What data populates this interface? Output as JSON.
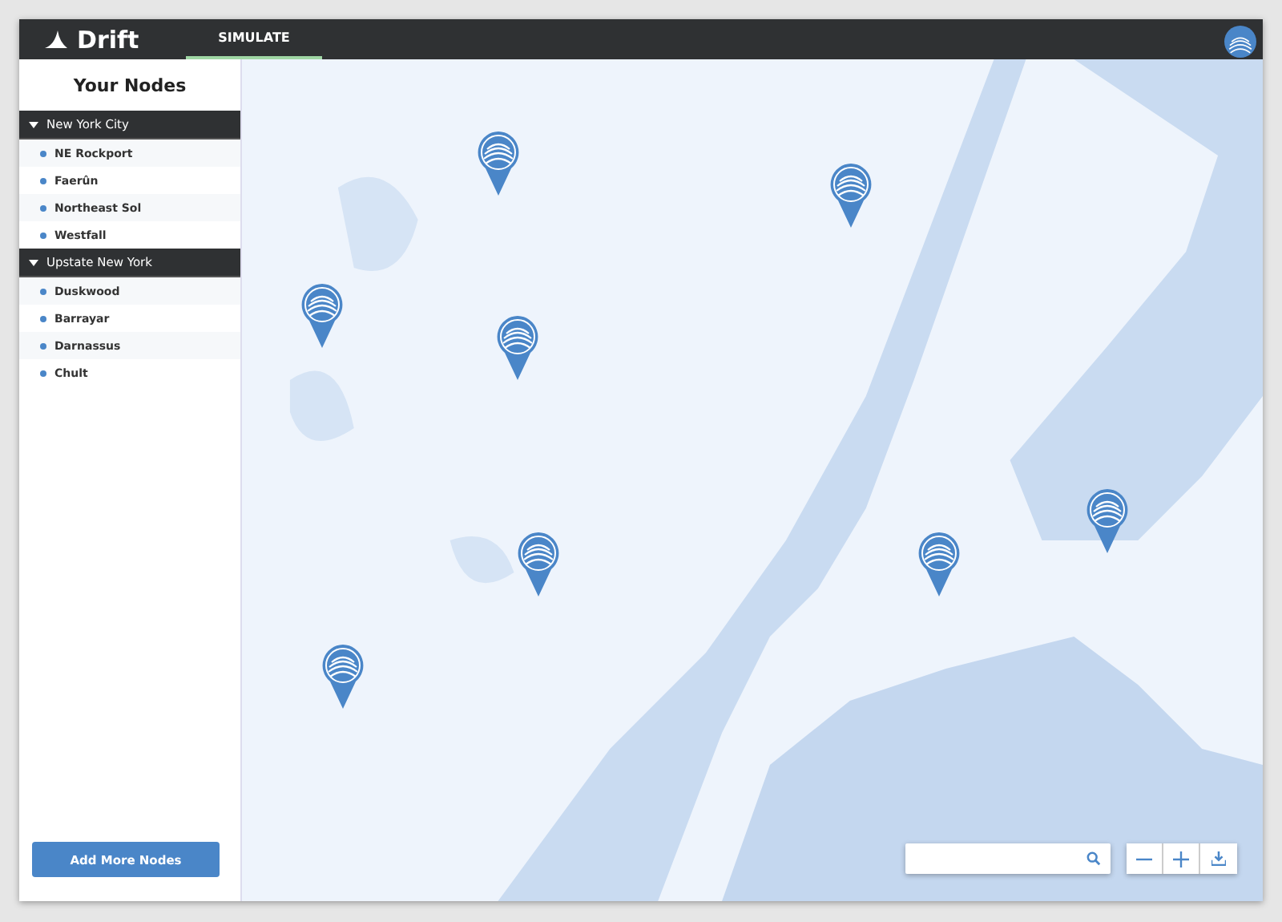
{
  "header": {
    "logo": "Drift",
    "tabs": [
      {
        "label": "SIMULATE",
        "selected": true
      }
    ]
  },
  "sidebar": {
    "title": "Your Nodes",
    "groups": [
      {
        "name": "New York City",
        "expanded": true,
        "nodes": [
          "NE Rockport",
          "Faerûn",
          "Northeast Sol",
          "Westfall"
        ]
      },
      {
        "name": "Upstate New York",
        "expanded": true,
        "nodes": [
          "Duskwood",
          "Barrayar",
          "Darnassus",
          "Chult"
        ]
      }
    ],
    "add_button": "Add More Nodes"
  }
}
